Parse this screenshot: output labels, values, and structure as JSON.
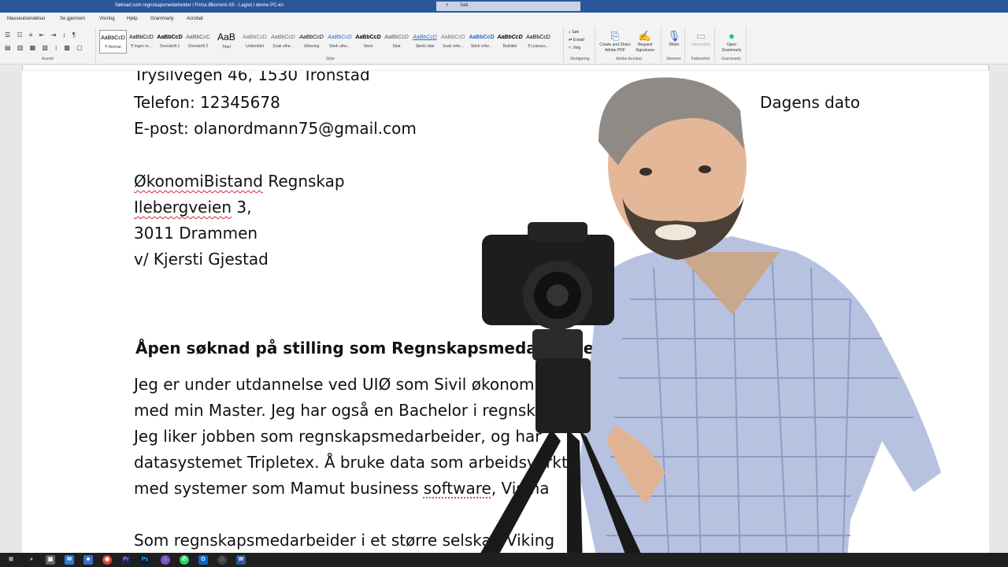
{
  "titlebar": {
    "title": "Søknad som regnskapsmedarbeider i Firma Økonomi AS  -  Lagret i denne PC-en",
    "search_placeholder": "Søk"
  },
  "tabs": [
    "Masseutsendelser",
    "Se gjennom",
    "Visning",
    "Hjelp",
    "Grammarly",
    "Acrobat"
  ],
  "ribbon": {
    "paragraph_label": "Avsnitt",
    "styles_label": "Stiler",
    "styles": [
      {
        "sample": "AaBbCcD",
        "name": "¶ Normal"
      },
      {
        "sample": "AaBbCcD",
        "name": "¶ Ingen m..."
      },
      {
        "sample": "AaBbCcD",
        "name": "Overskrift 1"
      },
      {
        "sample": "AaBbCcC",
        "name": "Overskrift 2"
      },
      {
        "sample": "AaB",
        "name": "Tittel"
      },
      {
        "sample": "AaBbCcD",
        "name": "Undertittel"
      },
      {
        "sample": "AaBbCcD",
        "name": "Svak uthe..."
      },
      {
        "sample": "AaBbCcD",
        "name": "Utheving"
      },
      {
        "sample": "AaBbCcD",
        "name": "Sterk uthe..."
      },
      {
        "sample": "AaBbCcD",
        "name": "Sterk"
      },
      {
        "sample": "AaBbCcD",
        "name": "Sitat"
      },
      {
        "sample": "AaBbCcD",
        "name": "Sterkt sitat"
      },
      {
        "sample": "AaBbCcD",
        "name": "Svak refer..."
      },
      {
        "sample": "AaBbCcD",
        "name": "Sterk refer..."
      },
      {
        "sample": "AaBbCcD",
        "name": "Boktittel"
      },
      {
        "sample": "AaBbCcD",
        "name": "¶ Listeavs..."
      }
    ],
    "editing": {
      "find": "Søk",
      "replace": "Erstatt",
      "select": "Velg",
      "label": "Redigering"
    },
    "acrobat": {
      "create": "Create and Share Adobe PDF",
      "request": "Request Signatures",
      "label": "Adobe Acrobat"
    },
    "voice": {
      "dictate": "Dikter",
      "label": "Stemme"
    },
    "sensitivity": {
      "btn": "Følsomhet",
      "label": "Følsomhet"
    },
    "grammarly": {
      "open": "Open Grammarly",
      "label": "Grammarly"
    }
  },
  "document": {
    "address_street": "Trysilvegen 46, 1530 Tronstad",
    "phone": "Telefon: 12345678",
    "date": "Dagens dato",
    "email": "E-post: olanordmann75@gmail.com",
    "company_name_a": "ØkonomiBistand",
    "company_name_b": " Regnskap",
    "company_street_a": "Ilebergveien",
    "company_street_b": " 3,",
    "company_city": "3011 Drammen",
    "company_contact": "v/ Kjersti Gjestad",
    "heading": "Åpen søknad på stilling som Regnskapsmedarbeider",
    "p1": "Jeg er under utdannelse ved UIØ som Sivil økonom",
    "p2": "med min Master. Jeg har også en Bachelor i regnskap",
    "p3": "Jeg liker jobben som regnskapsmedarbeider, og har",
    "p4": "datasystemet Tripletex. Å bruke data som arbeidsverktøy",
    "p5a": "med systemer som Mamut business ",
    "p5b": "software",
    "p5c": ", Visma",
    "p6": "Som regnskapsmedarbeider i et større selskap Viking"
  },
  "taskbar": {
    "icons": [
      "windows-icon",
      "search-icon",
      "store-icon",
      "mail-icon",
      "chrome-icon",
      "premiere-icon",
      "photoshop-icon",
      "app-icon",
      "whatsapp-icon",
      "outlook-icon",
      "vpn-icon",
      "word-icon"
    ]
  }
}
